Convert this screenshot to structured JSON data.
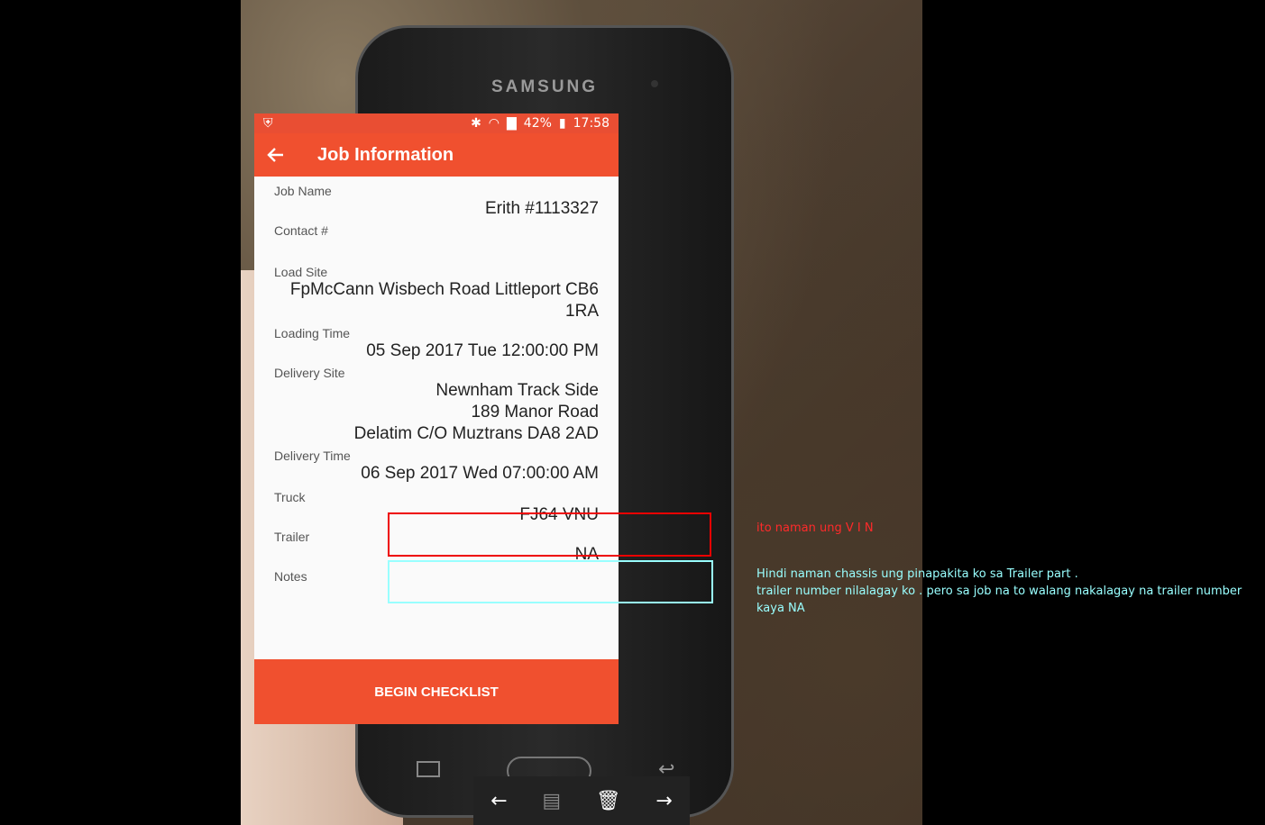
{
  "phone": {
    "brand": "SAMSUNG",
    "status": {
      "battery": "42%",
      "time": "17:58"
    }
  },
  "app": {
    "title": "Job Information",
    "fields": [
      {
        "label": "Job Name",
        "value": "Erith #1113327"
      },
      {
        "label": "Contact #",
        "value": ""
      },
      {
        "label": "Load Site",
        "value": "FpMcCann Wisbech Road Littleport CB6\n1RA"
      },
      {
        "label": "Loading Time",
        "value": "05 Sep 2017 Tue 12:00:00 PM"
      },
      {
        "label": "Delivery Site",
        "value": "Newnham Track Side\n189 Manor Road\nDelatim C/O Muztrans DA8 2AD"
      },
      {
        "label": "Delivery Time",
        "value": "06 Sep 2017 Wed 07:00:00 AM"
      },
      {
        "label": "Truck",
        "value": "FJ64 VNU"
      },
      {
        "label": "Trailer",
        "value": "NA"
      },
      {
        "label": "Notes",
        "value": ""
      }
    ],
    "begin_label": "BEGIN CHECKLIST"
  },
  "annotations": {
    "red_note": "ito naman ung V I N",
    "cyan_note_line1": "Hindi naman chassis ung pinapakita ko sa Trailer part .",
    "cyan_note_line2": "trailer number nilalagay ko . pero sa job na to walang nakalagay na trailer number",
    "cyan_note_line3": "kaya NA"
  },
  "colors": {
    "accent": "#f0502f",
    "highlight_red": "#ee0000",
    "highlight_cyan": "#99ffff"
  }
}
